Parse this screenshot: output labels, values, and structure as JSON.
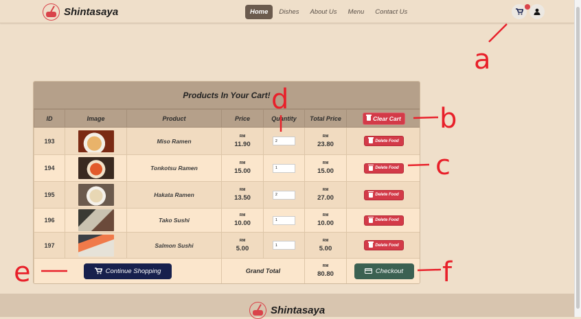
{
  "brand": "Shintasaya",
  "nav": {
    "items": [
      {
        "label": "Home",
        "active": true
      },
      {
        "label": "Dishes"
      },
      {
        "label": "About Us"
      },
      {
        "label": "Menu"
      },
      {
        "label": "Contact Us"
      }
    ]
  },
  "cart": {
    "title": "Products In Your Cart!",
    "columns": [
      "ID",
      "Image",
      "Product",
      "Price",
      "Quantity",
      "Total Price"
    ],
    "clear_label": "Clear Cart",
    "delete_label": "Delete Food",
    "currency": "RM",
    "rows": [
      {
        "id": "193",
        "product": "Miso Ramen",
        "price": "11.90",
        "qty": "2",
        "total": "23.80",
        "image": "miso-ramen"
      },
      {
        "id": "194",
        "product": "Tonkotsu Ramen",
        "price": "15.00",
        "qty": "1",
        "total": "15.00",
        "image": "tonkotsu-ramen"
      },
      {
        "id": "195",
        "product": "Hakata Ramen",
        "price": "13.50",
        "qty": "2",
        "total": "27.00",
        "image": "hakata-ramen"
      },
      {
        "id": "196",
        "product": "Tako Sushi",
        "price": "10.00",
        "qty": "1",
        "total": "10.00",
        "image": "tako-sushi"
      },
      {
        "id": "197",
        "product": "Salmon Sushi",
        "price": "5.00",
        "qty": "1",
        "total": "5.00",
        "image": "salmon-sushi"
      }
    ],
    "continue_label": "Continue Shopping",
    "grand_total_label": "Grand Total",
    "grand_total": "80.80",
    "checkout_label": "Checkout"
  },
  "annotations": [
    "a",
    "b",
    "c",
    "d",
    "e",
    "f"
  ],
  "colors": {
    "accent_red": "#d33a48",
    "navy": "#17204d",
    "green": "#3b6152",
    "header": "#b5a08a"
  }
}
